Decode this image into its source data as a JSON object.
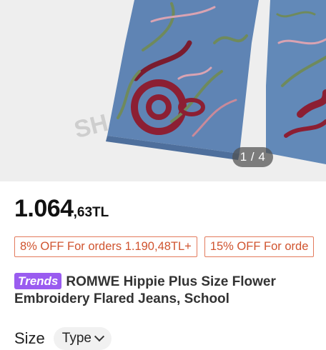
{
  "gallery": {
    "counter": "1 / 4",
    "watermark": "SH"
  },
  "price": {
    "major": "1.064",
    "minor": ",63TL"
  },
  "coupons": [
    {
      "label": "8% OFF For orders 1.190,48TL+"
    },
    {
      "label": "15% OFF For orde"
    }
  ],
  "product": {
    "badge": "Trends",
    "title": "ROMWE Hippie Plus Size Flower Embroidery Flared Jeans, School"
  },
  "size": {
    "label": "Size",
    "type_label": "Type"
  },
  "colors": {
    "coupon": "#d0542f",
    "badge": "#9a5cf0",
    "denim": "#5b7fae"
  }
}
